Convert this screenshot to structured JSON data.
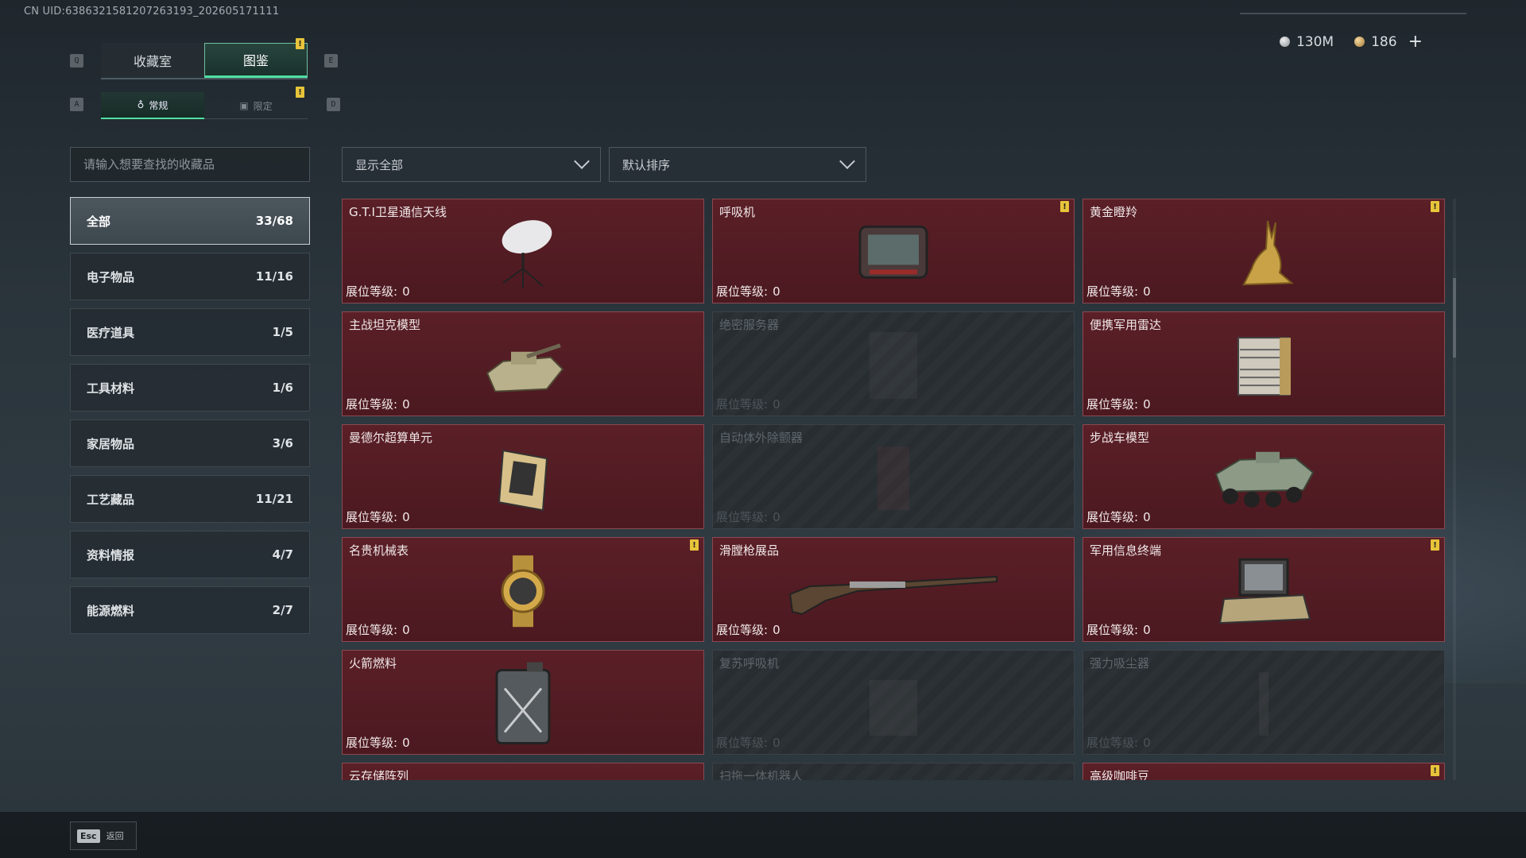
{
  "uid": "CN UID:6386321581207263193_202605171111",
  "tabs": {
    "collection": "收藏室",
    "catalog": "图鉴",
    "key_left": "Q",
    "key_right": "E"
  },
  "subtabs": {
    "regular": "常规",
    "limited": "限定",
    "key_left": "A",
    "key_right": "D"
  },
  "currency": {
    "silver": "130M",
    "gold": "186",
    "plus": "+"
  },
  "search": {
    "placeholder": "请输入想要查找的收藏品"
  },
  "filters": {
    "show": "显示全部",
    "sort": "默认排序"
  },
  "categories": [
    {
      "label": "全部",
      "count": "33/68",
      "active": true
    },
    {
      "label": "电子物品",
      "count": "11/16"
    },
    {
      "label": "医疗道具",
      "count": "1/5"
    },
    {
      "label": "工具材料",
      "count": "1/6"
    },
    {
      "label": "家居物品",
      "count": "3/6"
    },
    {
      "label": "工艺藏品",
      "count": "11/21"
    },
    {
      "label": "资料情报",
      "count": "4/7"
    },
    {
      "label": "能源燃料",
      "count": "2/7"
    }
  ],
  "level_label": "展位等级:",
  "items": [
    {
      "name": "G.T.I卫星通信天线",
      "level": "0",
      "owned": true,
      "badge": false,
      "icon": "satellite-dish-icon"
    },
    {
      "name": "呼吸机",
      "level": "0",
      "owned": true,
      "badge": true,
      "icon": "ventilator-icon"
    },
    {
      "name": "黄金瞪羚",
      "level": "0",
      "owned": true,
      "badge": true,
      "icon": "golden-gazelle-icon"
    },
    {
      "name": "主战坦克模型",
      "level": "0",
      "owned": true,
      "badge": false,
      "icon": "tank-model-icon"
    },
    {
      "name": "绝密服务器",
      "level": "0",
      "owned": false,
      "badge": false,
      "icon": "server-icon"
    },
    {
      "name": "便携军用雷达",
      "level": "0",
      "owned": true,
      "badge": false,
      "icon": "radar-icon"
    },
    {
      "name": "曼德尔超算单元",
      "level": "0",
      "owned": true,
      "badge": false,
      "icon": "supercomputer-unit-icon"
    },
    {
      "name": "自动体外除颤器",
      "level": "0",
      "owned": false,
      "badge": false,
      "icon": "defibrillator-icon"
    },
    {
      "name": "步战车模型",
      "level": "0",
      "owned": true,
      "badge": false,
      "icon": "ifv-model-icon"
    },
    {
      "name": "名贵机械表",
      "level": "0",
      "owned": true,
      "badge": true,
      "icon": "watch-icon"
    },
    {
      "name": "滑膛枪展品",
      "level": "0",
      "owned": true,
      "badge": false,
      "icon": "musket-icon"
    },
    {
      "name": "军用信息终端",
      "level": "0",
      "owned": true,
      "badge": true,
      "icon": "terminal-icon"
    },
    {
      "name": "火箭燃料",
      "level": "0",
      "owned": true,
      "badge": false,
      "icon": "fuel-can-icon"
    },
    {
      "name": "复苏呼吸机",
      "level": "0",
      "owned": false,
      "badge": false,
      "icon": "respirator-icon"
    },
    {
      "name": "强力吸尘器",
      "level": "0",
      "owned": false,
      "badge": false,
      "icon": "vacuum-icon"
    },
    {
      "name": "云存储阵列",
      "level": "",
      "owned": true,
      "badge": false,
      "icon": "storage-array-icon"
    },
    {
      "name": "扫拖一体机器人",
      "level": "",
      "owned": false,
      "badge": false,
      "icon": "robot-icon"
    },
    {
      "name": "高级咖啡豆",
      "level": "",
      "owned": true,
      "badge": true,
      "icon": "coffee-bean-icon"
    }
  ],
  "bottom": {
    "esc_key": "Esc",
    "back": "返回"
  }
}
